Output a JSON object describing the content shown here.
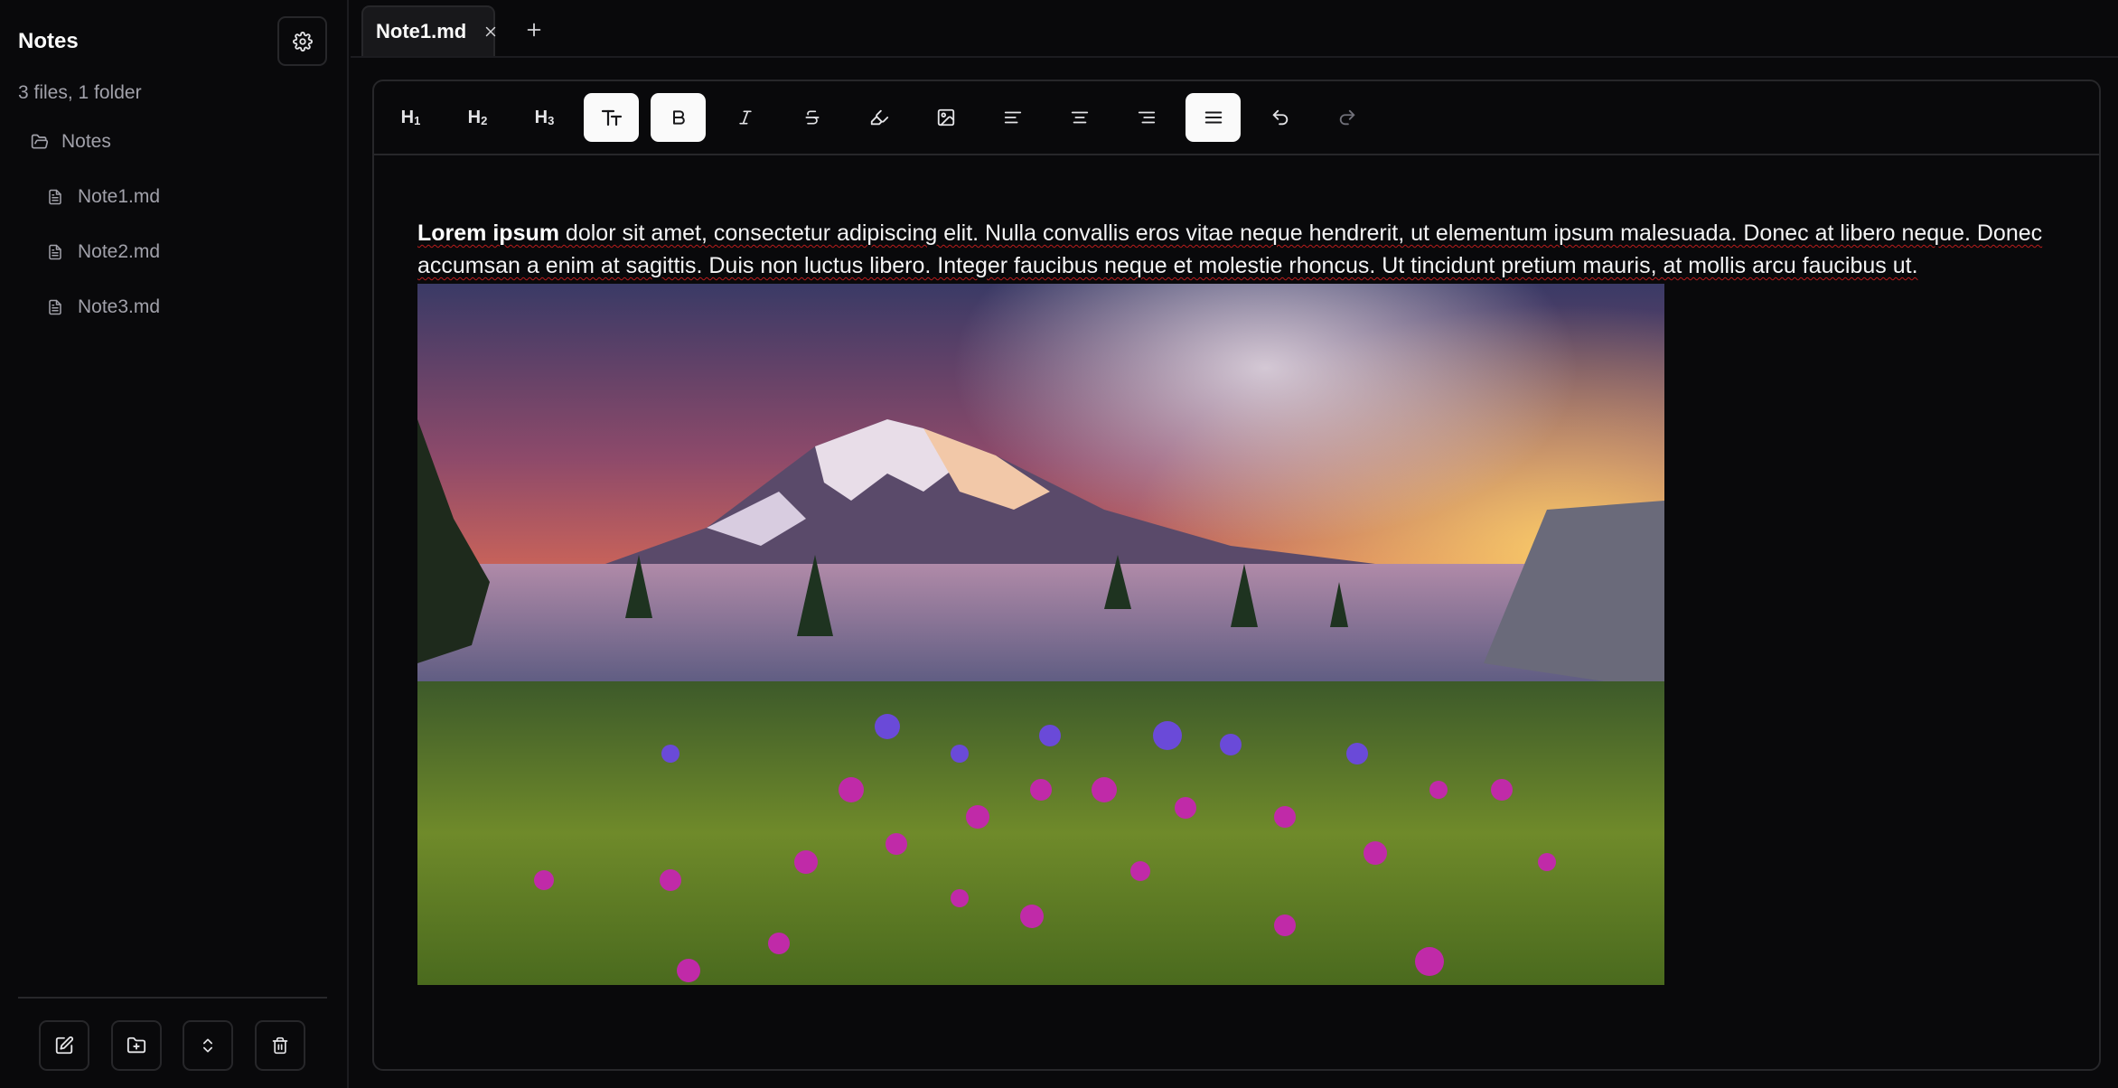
{
  "sidebar": {
    "title": "Notes",
    "count": "3 files, 1 folder",
    "folder": {
      "label": "Notes",
      "icon": "folder-open-icon"
    },
    "files": [
      {
        "label": "Note1.md",
        "icon": "file-text-icon"
      },
      {
        "label": "Note2.md",
        "icon": "file-text-icon"
      },
      {
        "label": "Note3.md",
        "icon": "file-text-icon"
      }
    ],
    "bottom_buttons": [
      "new-note-icon",
      "new-folder-icon",
      "expand-collapse-icon",
      "trash-icon"
    ]
  },
  "tabs": [
    {
      "label": "Note1.md",
      "active": true
    }
  ],
  "toolbar": {
    "h1": "H1",
    "h2": "H2",
    "h3": "H3",
    "active": [
      "text-size",
      "bold",
      "align-justify"
    ]
  },
  "document": {
    "bold_lead": "Lorem ipsum",
    "text": " dolor sit amet, consectetur adipiscing elit. Nulla convallis eros vitae neque hendrerit, ut elementum ipsum malesuada. Donec at libero neque. Donec accumsan a enim at sagittis. Duis non luctus libero. Integer faucibus neque et molestie rhoncus. Ut tincidunt pretium mauris, at mollis arcu faucibus ut."
  },
  "colors": {
    "background": "#09090b",
    "border": "#27272a",
    "active_button": "#fafafa",
    "muted_text": "#a1a1aa",
    "spellcheck": "#b91c1c"
  }
}
